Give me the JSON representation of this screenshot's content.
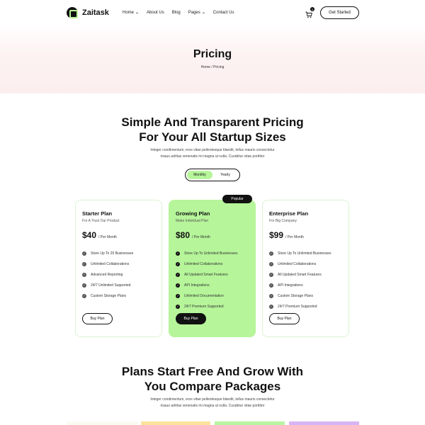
{
  "brand": {
    "name": "Zaitask"
  },
  "nav": {
    "items": [
      {
        "label": "Home",
        "dropdown": true
      },
      {
        "label": "About Us",
        "dropdown": false
      },
      {
        "label": "Blog",
        "dropdown": false
      },
      {
        "label": "Pages",
        "dropdown": true
      },
      {
        "label": "Contact Us",
        "dropdown": false
      }
    ],
    "cart_count": "0",
    "cta_label": "Get Started"
  },
  "hero": {
    "title": "Pricing",
    "breadcrumb": "Home / Pricing"
  },
  "pricing": {
    "title_line1": "Simple And Transparent Pricing",
    "title_line2": "For Your All Startup Sizes",
    "desc_line1": "Integer condimentum, eros vitae pellentesque blandit, tellus mauris consectetur",
    "desc_line2": "risaus adritas venenatis mi magna ut nulla. Curabitur vitae porttitor",
    "toggle": {
      "options": [
        "Monthly",
        "Yearly"
      ],
      "selected": "Monthly"
    },
    "popular_badge": "Popular",
    "plans": [
      {
        "name": "Starter Plan",
        "subtitle": "For A Trust Our Product",
        "price": "$40",
        "period": "/ Per Month",
        "features": [
          "Store Up To 20 Businesses",
          "Unlimited Collaborations",
          "Advanced Reporting",
          "24/7 Unlimited Supported",
          "Custom Storage Plans"
        ],
        "button": "Buy Plan"
      },
      {
        "name": "Growing Plan",
        "subtitle": "Make Individual Plan",
        "price": "$80",
        "period": "/ Per Month",
        "features": [
          "Store Up To Unlimited Businesses",
          "Unlimited Collaborations",
          "All Updated Smart Features",
          "API Integrations",
          "Unlimited Documentation",
          "24/7 Premium Supported"
        ],
        "button": "Buy Plan"
      },
      {
        "name": "Enterprise Plan",
        "subtitle": "For Big Company",
        "price": "$99",
        "period": "/ Per Month",
        "features": [
          "Store Up To Unlimited Businesses",
          "Unlimited Collaborations",
          "All Updated Smart Features",
          "API Integrations",
          "Custom Storage Plans",
          "24/7 Premium Supported"
        ],
        "button": "Buy Plan"
      }
    ]
  },
  "packages": {
    "title_line1": "Plans Start Free And Grow With",
    "title_line2": "You Compare Packages",
    "desc_line1": "Integer condimentum, eros vitae pellentesque blandit, tellus mauris consectetur",
    "desc_line2": "risaus adritas venenatis mi magna ut nulla. Curabitur vitae porttitor"
  },
  "colors": {
    "accent": "#b6f59a",
    "strip_1": "#fbfaf1",
    "strip_2": "#fde29b",
    "strip_3": "#b8f5a2",
    "strip_4": "#d7b5f5"
  }
}
